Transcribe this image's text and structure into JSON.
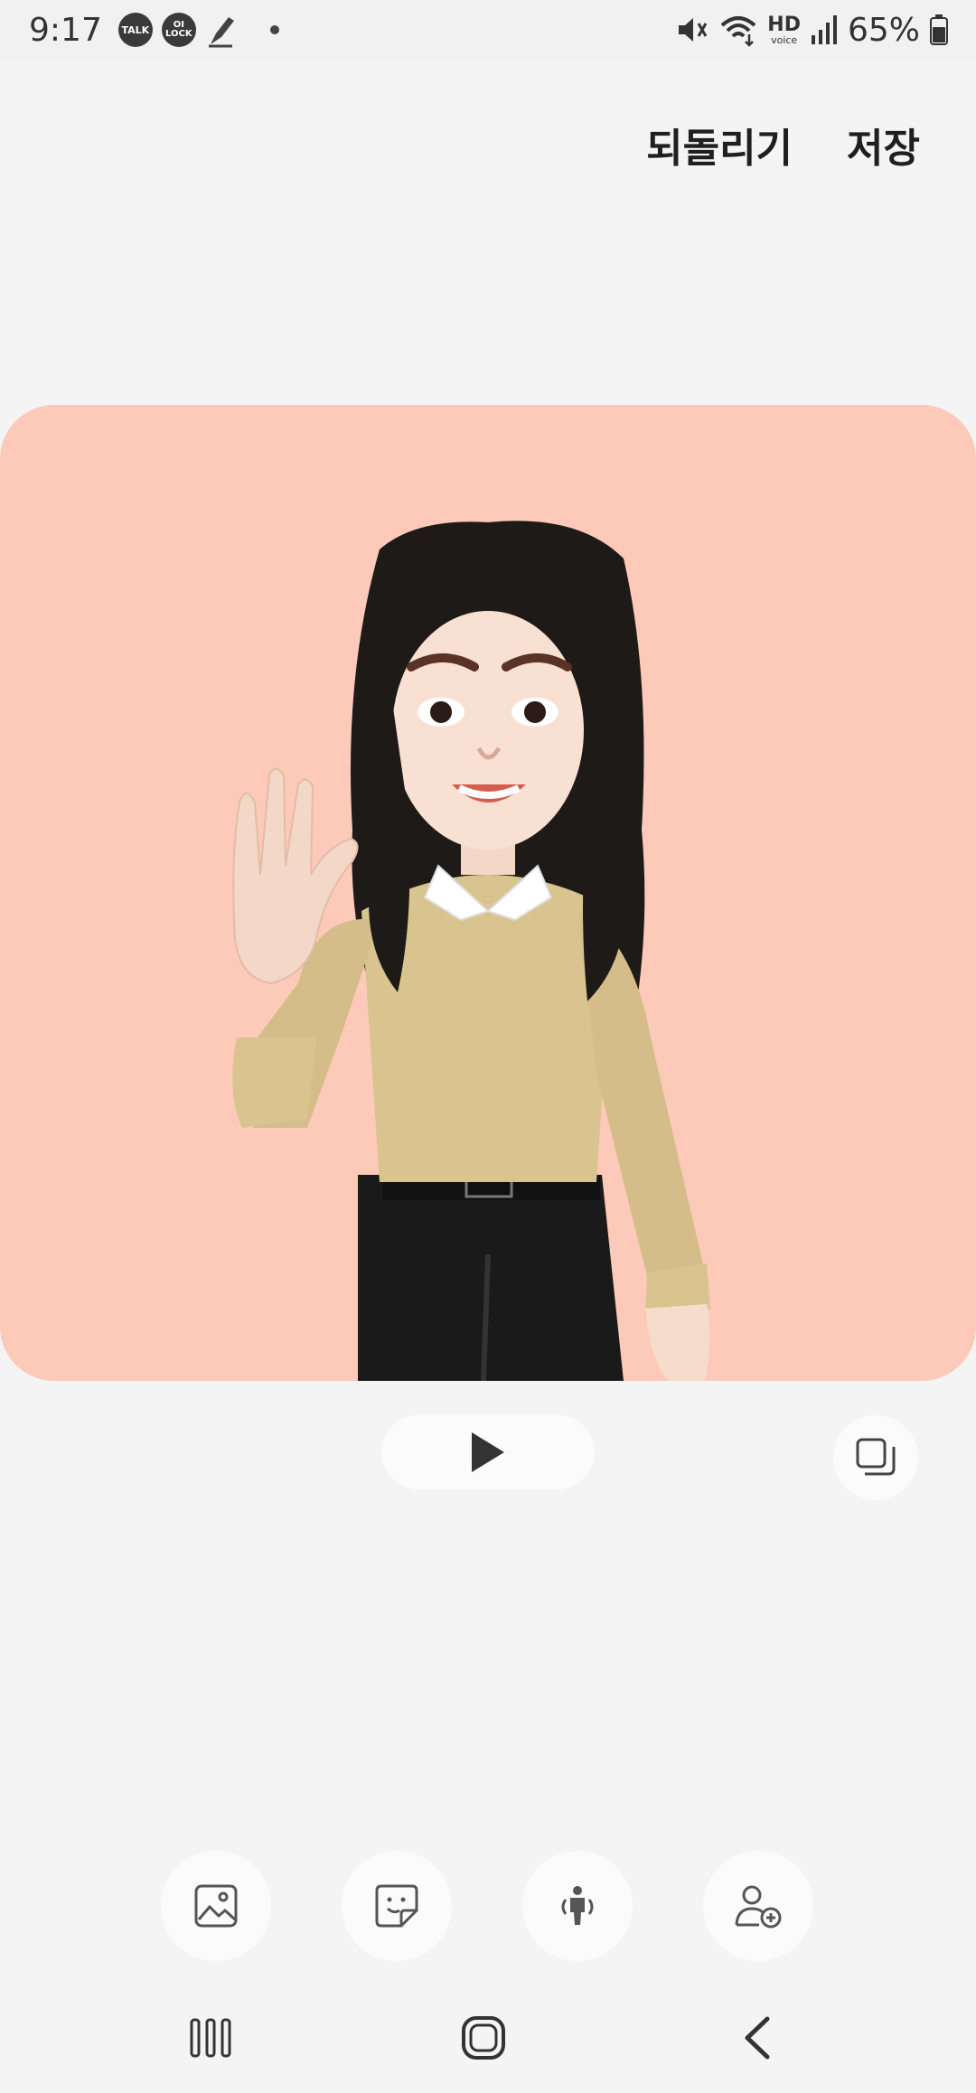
{
  "status_bar": {
    "time": "9:17",
    "badges": [
      "TALK",
      "OI LOCK"
    ],
    "battery_percent": "65%",
    "icons": [
      "mute-icon",
      "wifi-icon",
      "hd-voice-icon",
      "signal-icon",
      "battery-icon"
    ],
    "hd_label": "HD",
    "voice_label": "voice"
  },
  "header": {
    "revert_label": "되돌리기",
    "save_label": "저장"
  },
  "avatar": {
    "background_color": "#fdc9b9"
  },
  "controls": {
    "play_icon": "play-icon",
    "copy_icon": "copy-icon"
  },
  "toolbar": {
    "items": [
      {
        "icon": "image-icon"
      },
      {
        "icon": "sticker-icon"
      },
      {
        "icon": "body-pose-icon"
      },
      {
        "icon": "add-person-icon"
      }
    ]
  },
  "nav": {
    "items": [
      "recent-apps-icon",
      "home-icon",
      "back-icon"
    ]
  }
}
